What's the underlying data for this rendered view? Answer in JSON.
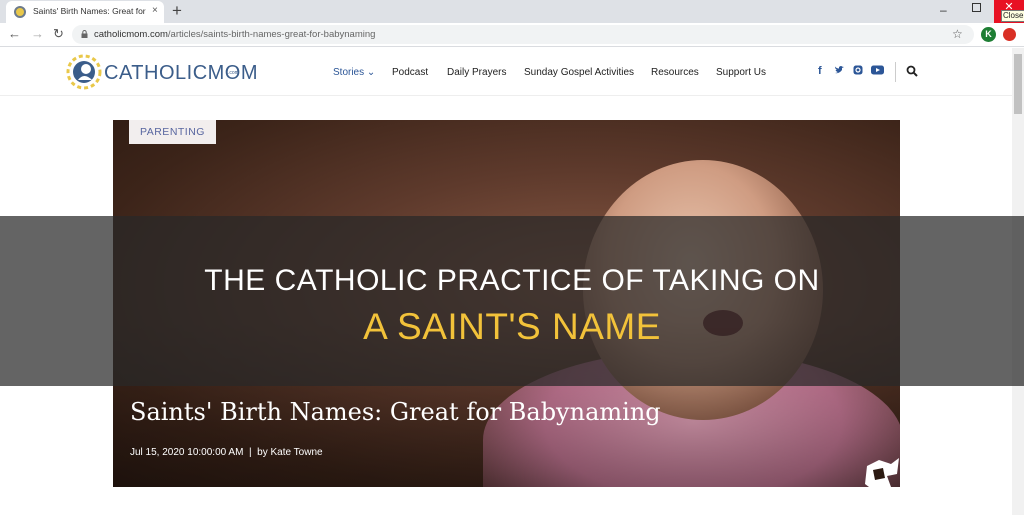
{
  "browser": {
    "tab_title": "Saints' Birth Names: Great for Babynaming",
    "tab_close": "×",
    "new_tab": "+",
    "minimize": "–",
    "close_tooltip": "Close",
    "url_domain": "catholicmom.com",
    "url_path": "/articles/saints-birth-names-great-for-babynaming",
    "profile_initial": "K"
  },
  "site": {
    "logo_text": "CATHOLICMOM",
    "logo_suffix": ".com",
    "nav": {
      "stories": "Stories",
      "podcast": "Podcast",
      "daily_prayers": "Daily Prayers",
      "sunday_gospel": "Sunday Gospel Activities",
      "resources": "Resources",
      "support_us": "Support Us"
    },
    "social": [
      "f",
      "t",
      "i",
      "y"
    ]
  },
  "article": {
    "category": "PARENTING",
    "title": "Saints' Birth Names: Great for Babynaming",
    "date": "Jul 15, 2020 10:00:00 AM",
    "separator": "|",
    "author": "by Kate Towne"
  },
  "overlay": {
    "line1": "THE CATHOLIC PRACTICE OF TAKING ON",
    "line2": "A SAINT'S NAME"
  },
  "colors": {
    "brand_blue": "#2c5697",
    "overlay_yellow": "#f2c23a",
    "close_red": "#e81123"
  }
}
